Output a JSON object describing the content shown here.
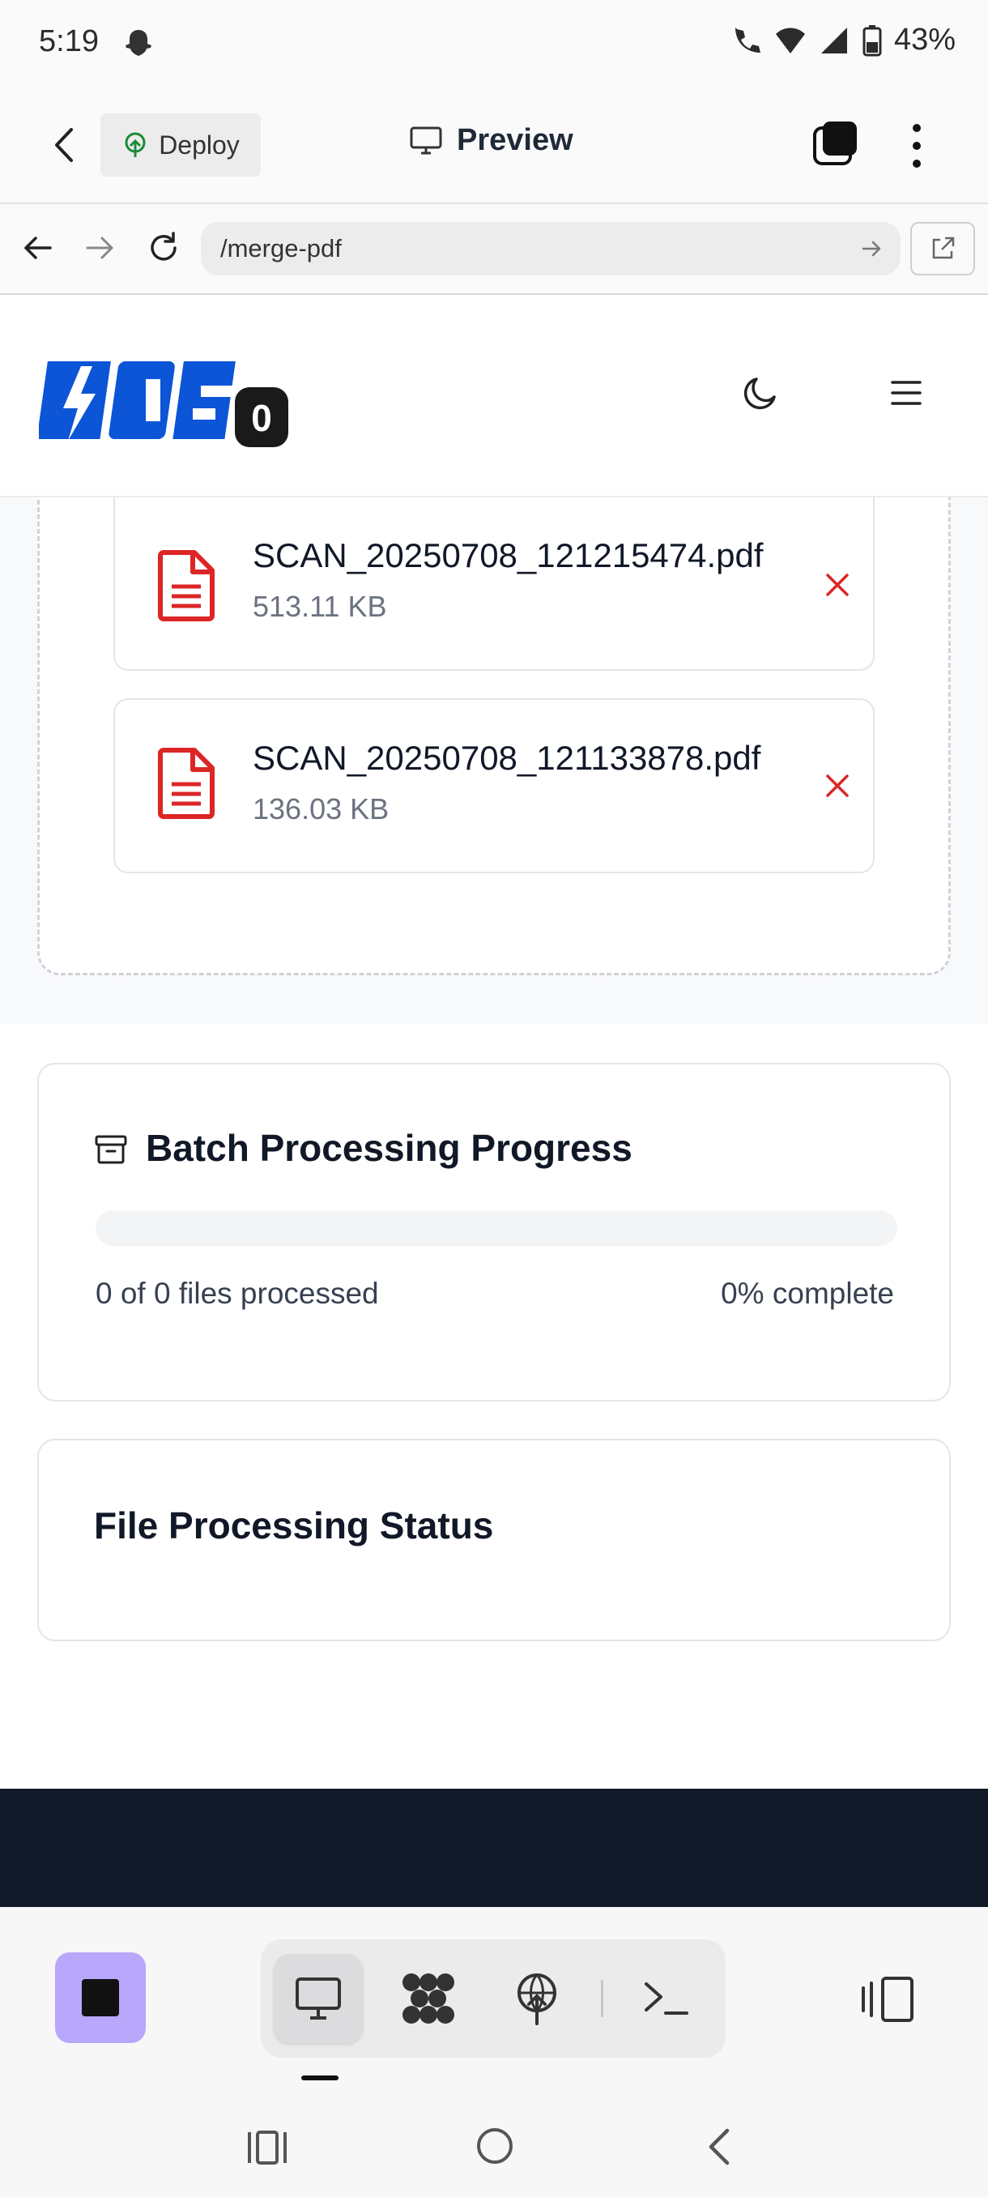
{
  "status_bar": {
    "time": "5:19",
    "battery": "43%"
  },
  "app_header": {
    "deploy_label": "Deploy",
    "preview_label": "Preview"
  },
  "browser": {
    "url": "/merge-pdf"
  },
  "site": {
    "logo_text": "PDF",
    "logo_badge": "0"
  },
  "files": [
    {
      "name": "SCAN_20250708_121215474.pdf",
      "size": "513.11 KB"
    },
    {
      "name": "SCAN_20250708_121133878.pdf",
      "size": "136.03 KB"
    }
  ],
  "batch": {
    "title": "Batch Processing Progress",
    "processed_text": "0 of 0 files processed",
    "complete_text": "0% complete",
    "progress_fraction": 0
  },
  "file_status": {
    "title": "File Processing Status"
  },
  "colors": {
    "accent_purple": "#b8a7fb",
    "file_red": "#dc2626",
    "logo_blue": "#0b55d6",
    "footer": "#111827"
  }
}
